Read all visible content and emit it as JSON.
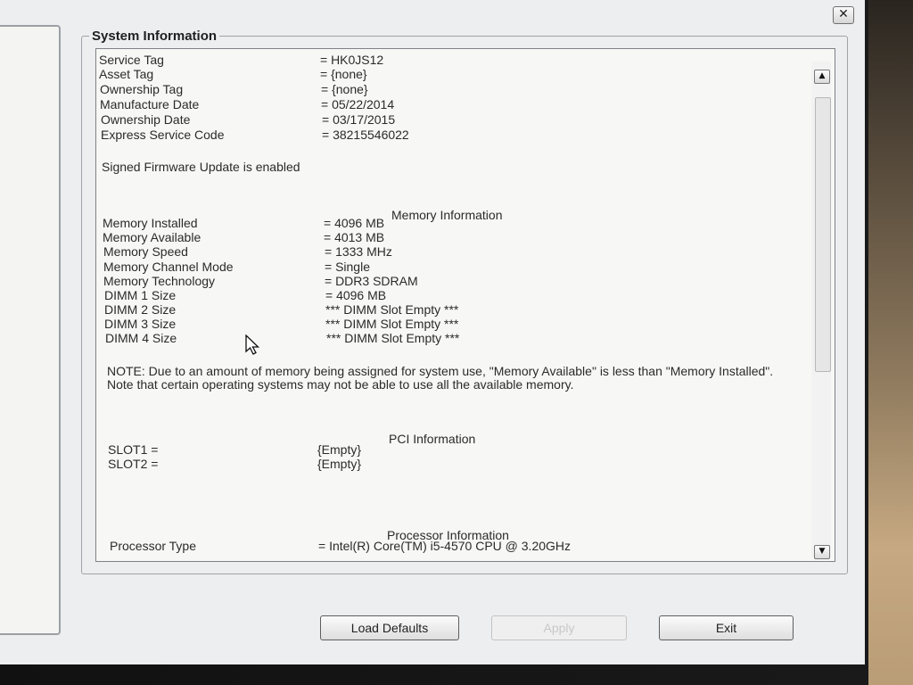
{
  "window": {
    "close_label": "✕"
  },
  "group": {
    "title": "System Information"
  },
  "system": [
    {
      "label": "Service Tag",
      "value": "= HK0JS12"
    },
    {
      "label": "Asset Tag",
      "value": "= {none}"
    },
    {
      "label": "Ownership Tag",
      "value": "= {none}"
    },
    {
      "label": "Manufacture Date",
      "value": "= 05/22/2014"
    },
    {
      "label": "Ownership Date",
      "value": "= 03/17/2015"
    },
    {
      "label": "Express Service Code",
      "value": "= 38215546022"
    }
  ],
  "firmware_note": "Signed Firmware Update is enabled",
  "memory": {
    "heading": "Memory Information",
    "rows": [
      {
        "label": "Memory Installed",
        "value": "= 4096 MB"
      },
      {
        "label": "Memory Available",
        "value": "= 4013 MB"
      },
      {
        "label": "Memory Speed",
        "value": "= 1333 MHz"
      },
      {
        "label": "Memory Channel Mode",
        "value": "= Single"
      },
      {
        "label": "Memory Technology",
        "value": "= DDR3 SDRAM"
      },
      {
        "label": "DIMM 1 Size",
        "value": "= 4096 MB"
      },
      {
        "label": "DIMM 2 Size",
        "value": "*** DIMM Slot Empty ***"
      },
      {
        "label": "DIMM 3 Size",
        "value": "*** DIMM Slot Empty ***"
      },
      {
        "label": "DIMM 4 Size",
        "value": "*** DIMM Slot Empty ***"
      }
    ],
    "note": "NOTE: Due to an amount of memory being assigned for system use, \"Memory Available\" is less than \"Memory Installed\". Note that certain operating systems may not be able to use all the available memory."
  },
  "pci": {
    "heading": "PCI Information",
    "rows": [
      {
        "label": "SLOT1 =",
        "value": "{Empty}"
      },
      {
        "label": "SLOT2 =",
        "value": "{Empty}"
      }
    ]
  },
  "processor": {
    "heading": "Processor Information",
    "rows": [
      {
        "label": "Processor Type",
        "value": "= Intel(R) Core(TM) i5-4570 CPU @ 3.20GHz"
      }
    ]
  },
  "scrollbar": {
    "up_glyph": "▲",
    "down_glyph": "▼"
  },
  "buttons": {
    "load_defaults": "Load Defaults",
    "apply": "Apply",
    "exit": "Exit"
  }
}
